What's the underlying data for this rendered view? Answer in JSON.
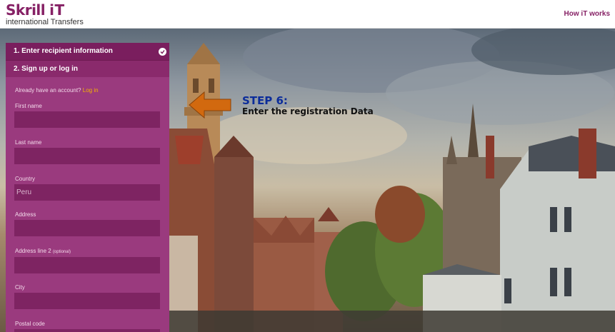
{
  "header": {
    "logo_brand": "Skrill",
    "logo_suffix": "iT",
    "logo_sub": "international Transfers",
    "how_link": "How iT works"
  },
  "steps": [
    {
      "label": "1. Enter recipient information",
      "completed": true
    },
    {
      "label": "2. Sign up or log in",
      "completed": false
    }
  ],
  "account_prompt": "Already have an account?",
  "login_link": "Log in",
  "fields": [
    {
      "label": "First name",
      "value": ""
    },
    {
      "label": "Last name",
      "value": ""
    },
    {
      "label": "Country",
      "value": "Peru"
    },
    {
      "label": "Address",
      "value": ""
    },
    {
      "label": "Address line 2",
      "optional": "(optional)",
      "value": ""
    },
    {
      "label": "City",
      "value": ""
    },
    {
      "label": "Postal code",
      "value": ""
    }
  ],
  "callout": {
    "title": "STEP 6:",
    "text": "Enter the registration Data",
    "arrow_icon": "left-arrow-icon"
  },
  "colors": {
    "brand": "#862165",
    "panel": "#9a3a7e",
    "input": "#7e2462",
    "link_accent": "#f5b400",
    "arrow": "#d2690f",
    "step_title": "#0b2c9a"
  }
}
